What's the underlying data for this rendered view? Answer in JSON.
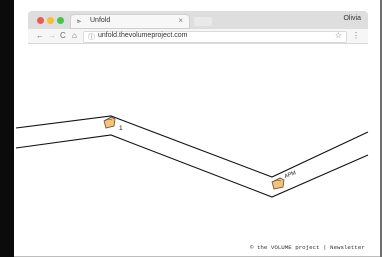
{
  "browser": {
    "tab": {
      "title": "Unfold",
      "close": "×"
    },
    "profile": "Olivia",
    "address": {
      "url": "unfold.thevolumeproject.com"
    },
    "icons": {
      "tab_favicon": "unfold-icon",
      "back": "back-arrow-icon",
      "forward": "forward-arrow-icon",
      "reload": "reload-icon",
      "home": "home-icon",
      "info": "info-icon",
      "star": "star-icon",
      "menu": "menu-icon"
    },
    "colors": {
      "tab_strip": "#dedede",
      "left_bar": "#0b0b0b"
    }
  },
  "page": {
    "markers": [
      {
        "icon": "folder-icon",
        "label": "1"
      },
      {
        "icon": "folder-icon",
        "label": "APM"
      }
    ],
    "footer": {
      "copyright": "© the VOLUME project",
      "separator": "|",
      "link": "Newsletter"
    }
  }
}
